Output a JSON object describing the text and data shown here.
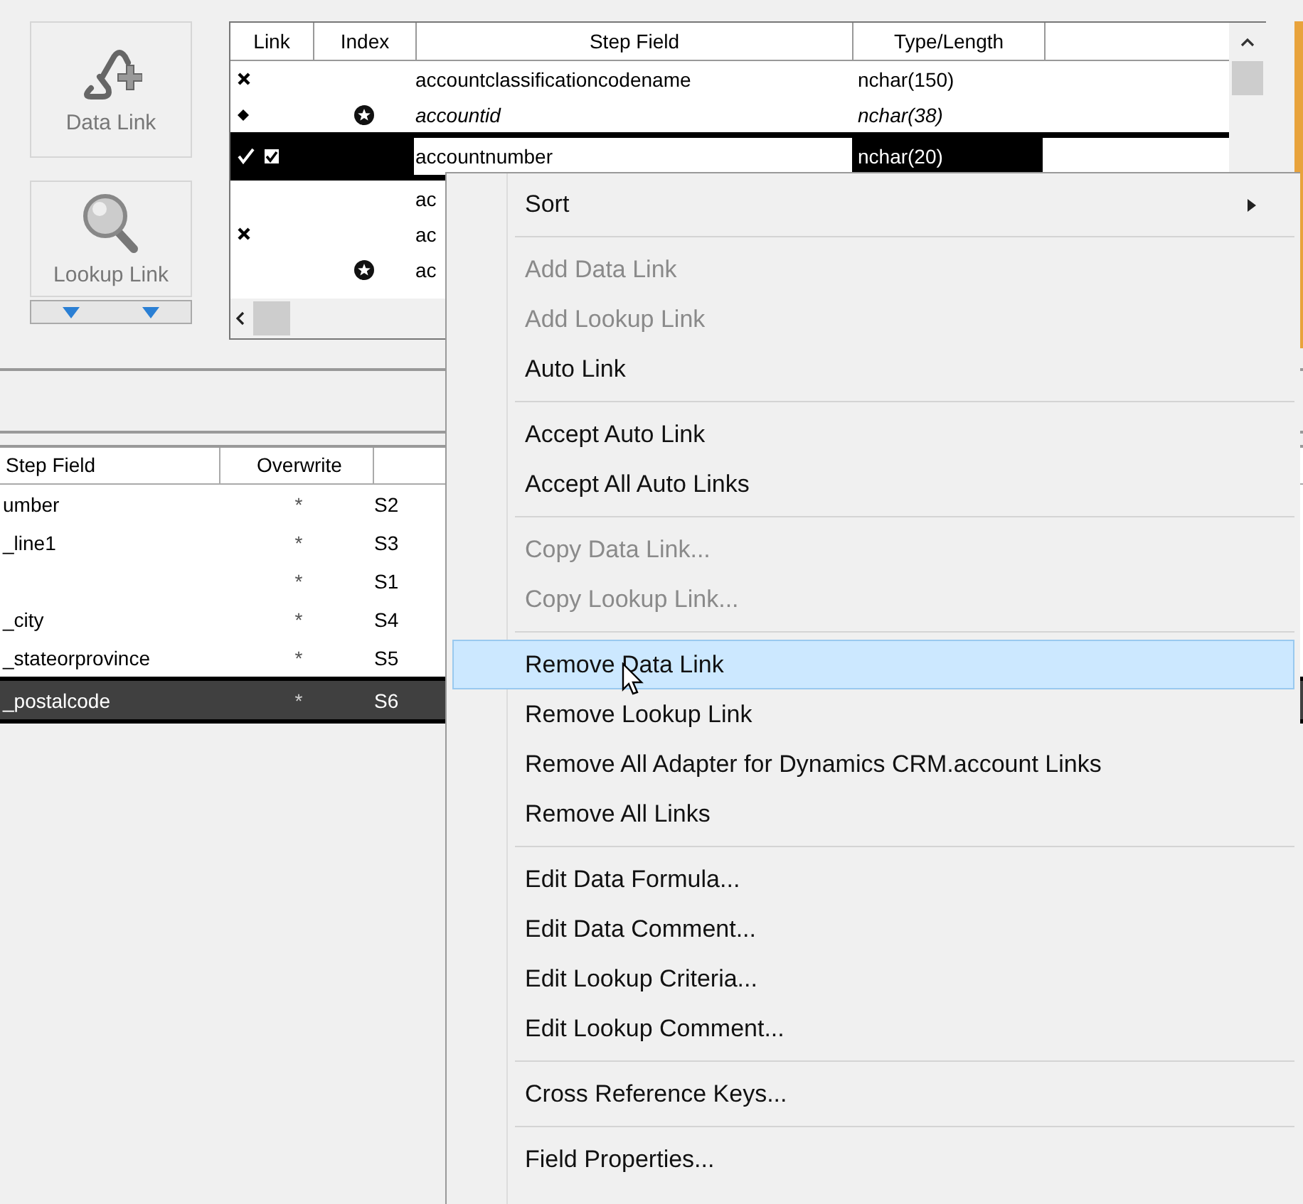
{
  "toolbar": {
    "buttons": [
      {
        "label": "Data Link",
        "kind": "data"
      },
      {
        "label": "Lookup Link",
        "kind": "lookup"
      }
    ]
  },
  "link_grid": {
    "columns": [
      "Link",
      "Index",
      "Step Field",
      "Type/Length"
    ],
    "rows": [
      {
        "kind": "cross",
        "checked": false,
        "indexed": false,
        "step_field": "accountclassificationcodename",
        "type_length": "nchar(150)",
        "italic": false,
        "selected": false
      },
      {
        "kind": "diamond",
        "checked": false,
        "indexed": true,
        "step_field": "accountid",
        "type_length": "nchar(38)",
        "italic": true,
        "selected": false
      },
      {
        "kind": "check",
        "checked": true,
        "indexed": false,
        "step_field": "accountnumber",
        "type_length": "nchar(20)",
        "italic": false,
        "selected": true
      },
      {
        "kind": "plain",
        "checked": false,
        "indexed": false,
        "step_field": "ac",
        "italic": false,
        "selected": false
      },
      {
        "kind": "cross",
        "checked": false,
        "indexed": false,
        "step_field": "ac",
        "italic": false,
        "selected": false
      },
      {
        "kind": "plain",
        "checked": false,
        "indexed": true,
        "step_field": "ac",
        "italic": false,
        "selected": false
      }
    ]
  },
  "mapping_grid": {
    "columns": [
      "Step Field",
      "Overwrite"
    ],
    "rows": [
      {
        "step_field": "umber",
        "overwrite": "*",
        "column_3": "S2",
        "selected": false
      },
      {
        "step_field": "_line1",
        "overwrite": "*",
        "column_3": "S3",
        "selected": false
      },
      {
        "overwrite": "*",
        "column_3": "S1",
        "selected": false
      },
      {
        "step_field": "_city",
        "overwrite": "*",
        "column_3": "S4",
        "selected": false
      },
      {
        "step_field": "_stateorprovince",
        "overwrite": "*",
        "column_3": "S5",
        "selected": false
      },
      {
        "step_field": "_postalcode",
        "overwrite": "*",
        "column_3": "S6",
        "selected": true
      }
    ]
  },
  "context_menu": {
    "items": [
      {
        "kind": "item",
        "label": "Sort",
        "submenu": true,
        "disabled": false,
        "selected": false
      },
      {
        "kind": "separator"
      },
      {
        "kind": "item",
        "label": "Add Data Link",
        "submenu": false,
        "disabled": true,
        "selected": false
      },
      {
        "kind": "item",
        "label": "Add Lookup Link",
        "submenu": false,
        "disabled": true,
        "selected": false
      },
      {
        "kind": "item",
        "label": "Auto Link",
        "submenu": false,
        "disabled": false,
        "selected": false
      },
      {
        "kind": "separator"
      },
      {
        "kind": "item",
        "label": "Accept Auto Link",
        "submenu": false,
        "disabled": false,
        "selected": false
      },
      {
        "kind": "item",
        "label": "Accept All Auto Links",
        "submenu": false,
        "disabled": false,
        "selected": false
      },
      {
        "kind": "separator"
      },
      {
        "kind": "item",
        "label": "Copy Data Link...",
        "submenu": false,
        "disabled": true,
        "selected": false
      },
      {
        "kind": "item",
        "label": "Copy Lookup Link...",
        "submenu": false,
        "disabled": true,
        "selected": false
      },
      {
        "kind": "separator"
      },
      {
        "kind": "item",
        "label": "Remove Data Link",
        "submenu": false,
        "disabled": false,
        "selected": true
      },
      {
        "kind": "item",
        "label": "Remove Lookup Link",
        "submenu": false,
        "disabled": false,
        "selected": false
      },
      {
        "kind": "item",
        "label": "Remove All Adapter for Dynamics CRM.account Links",
        "submenu": false,
        "disabled": false,
        "selected": false
      },
      {
        "kind": "item",
        "label": "Remove All Links",
        "submenu": false,
        "disabled": false,
        "selected": false
      },
      {
        "kind": "separator"
      },
      {
        "kind": "item",
        "label": "Edit Data Formula...",
        "submenu": false,
        "disabled": false,
        "selected": false
      },
      {
        "kind": "item",
        "label": "Edit Data Comment...",
        "submenu": false,
        "disabled": false,
        "selected": false
      },
      {
        "kind": "item",
        "label": "Edit Lookup Criteria...",
        "submenu": false,
        "disabled": false,
        "selected": false
      },
      {
        "kind": "item",
        "label": "Edit Lookup Comment...",
        "submenu": false,
        "disabled": false,
        "selected": false
      },
      {
        "kind": "separator"
      },
      {
        "kind": "item",
        "label": "Cross Reference Keys...",
        "submenu": false,
        "disabled": false,
        "selected": false
      },
      {
        "kind": "separator"
      },
      {
        "kind": "item",
        "label": "Field Properties...",
        "submenu": false,
        "disabled": false,
        "selected": false
      }
    ]
  }
}
